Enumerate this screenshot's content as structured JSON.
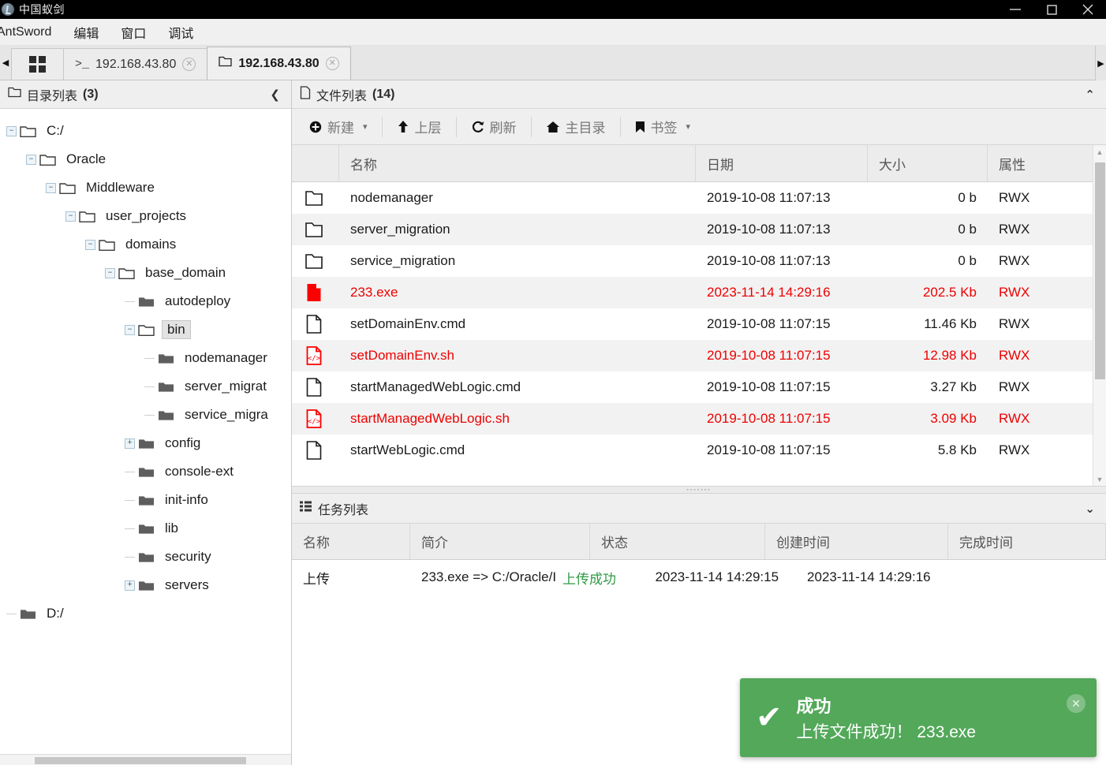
{
  "window": {
    "title": "中国蚁剑",
    "logo_icon": "antsword-logo-icon",
    "minimize_icon": "minimize-icon",
    "maximize_icon": "maximize-icon",
    "close_icon": "close-icon"
  },
  "menubar": {
    "items": [
      {
        "label": "AntSword"
      },
      {
        "label": "编辑"
      },
      {
        "label": "窗口"
      },
      {
        "label": "调试"
      }
    ]
  },
  "tabbar": {
    "scroll_left_icon": "chevron-left-icon",
    "scroll_right_icon": "chevron-right-icon",
    "home_tab_icon": "grid-icon",
    "tabs": [
      {
        "label": "192.168.43.80",
        "icon": "terminal-icon",
        "active": false,
        "close_icon": "close-circle-icon"
      },
      {
        "label": "192.168.43.80",
        "icon": "folder-icon",
        "active": true,
        "close_icon": "close-circle-icon"
      }
    ]
  },
  "sidebar": {
    "title": "目录列表",
    "count": "(3)",
    "title_icon": "folder-icon",
    "collapse_icon": "chevron-left-icon",
    "tree": [
      {
        "label": "C:/",
        "depth": 0,
        "expander": "minus",
        "icon": "folder-open-icon",
        "selected": false
      },
      {
        "label": "Oracle",
        "depth": 1,
        "expander": "minus",
        "icon": "folder-open-icon",
        "selected": false
      },
      {
        "label": "Middleware",
        "depth": 2,
        "expander": "minus",
        "icon": "folder-open-icon",
        "selected": false
      },
      {
        "label": "user_projects",
        "depth": 3,
        "expander": "minus",
        "icon": "folder-open-icon",
        "selected": false
      },
      {
        "label": "domains",
        "depth": 4,
        "expander": "minus",
        "icon": "folder-open-icon",
        "selected": false
      },
      {
        "label": "base_domain",
        "depth": 5,
        "expander": "minus",
        "icon": "folder-open-icon",
        "selected": false
      },
      {
        "label": "autodeploy",
        "depth": 6,
        "expander": "leaf",
        "icon": "folder-closed-icon",
        "selected": false
      },
      {
        "label": "bin",
        "depth": 6,
        "expander": "minus",
        "icon": "folder-open-icon",
        "selected": true
      },
      {
        "label": "nodemanager",
        "depth": 7,
        "expander": "leaf",
        "icon": "folder-closed-icon",
        "selected": false
      },
      {
        "label": "server_migrat",
        "depth": 7,
        "expander": "leaf",
        "icon": "folder-closed-icon",
        "selected": false
      },
      {
        "label": "service_migra",
        "depth": 7,
        "expander": "leaf",
        "icon": "folder-closed-icon",
        "selected": false
      },
      {
        "label": "config",
        "depth": 6,
        "expander": "plus",
        "icon": "folder-closed-icon",
        "selected": false
      },
      {
        "label": "console-ext",
        "depth": 6,
        "expander": "leaf",
        "icon": "folder-closed-icon",
        "selected": false
      },
      {
        "label": "init-info",
        "depth": 6,
        "expander": "leaf",
        "icon": "folder-closed-icon",
        "selected": false
      },
      {
        "label": "lib",
        "depth": 6,
        "expander": "leaf",
        "icon": "folder-closed-icon",
        "selected": false
      },
      {
        "label": "security",
        "depth": 6,
        "expander": "leaf",
        "icon": "folder-closed-icon",
        "selected": false
      },
      {
        "label": "servers",
        "depth": 6,
        "expander": "plus",
        "icon": "folder-closed-icon",
        "selected": false
      },
      {
        "label": "D:/",
        "depth": 0,
        "expander": "leaf",
        "icon": "folder-closed-icon",
        "selected": false
      }
    ]
  },
  "filelist": {
    "title": "文件列表",
    "count": "(14)",
    "title_icon": "file-icon",
    "collapse_icon": "chevron-up-icon",
    "toolbar": [
      {
        "label": "新建",
        "icon": "plus-circle-icon",
        "caret": "▾"
      },
      {
        "label": "上层",
        "icon": "arrow-up-icon",
        "caret": ""
      },
      {
        "label": "刷新",
        "icon": "refresh-icon",
        "caret": ""
      },
      {
        "label": "主目录",
        "icon": "home-icon",
        "caret": ""
      },
      {
        "label": "书签",
        "icon": "bookmark-icon",
        "caret": "▾"
      }
    ],
    "columns": [
      "",
      "名称",
      "日期",
      "大小",
      "属性"
    ],
    "rows": [
      {
        "name": "nodemanager",
        "date": "2019-10-08 11:07:13",
        "size": "0 b",
        "attr": "RWX",
        "icon": "folder-icon",
        "red": false
      },
      {
        "name": "server_migration",
        "date": "2019-10-08 11:07:13",
        "size": "0 b",
        "attr": "RWX",
        "icon": "folder-icon",
        "red": false
      },
      {
        "name": "service_migration",
        "date": "2019-10-08 11:07:13",
        "size": "0 b",
        "attr": "RWX",
        "icon": "folder-icon",
        "red": false
      },
      {
        "name": "233.exe",
        "date": "2023-11-14 14:29:16",
        "size": "202.5 Kb",
        "attr": "RWX",
        "icon": "exe-file-icon",
        "red": true
      },
      {
        "name": "setDomainEnv.cmd",
        "date": "2019-10-08 11:07:15",
        "size": "11.46 Kb",
        "attr": "RWX",
        "icon": "file-icon",
        "red": false
      },
      {
        "name": "setDomainEnv.sh",
        "date": "2019-10-08 11:07:15",
        "size": "12.98 Kb",
        "attr": "RWX",
        "icon": "code-file-icon",
        "red": true
      },
      {
        "name": "startManagedWebLogic.cmd",
        "date": "2019-10-08 11:07:15",
        "size": "3.27 Kb",
        "attr": "RWX",
        "icon": "file-icon",
        "red": false
      },
      {
        "name": "startManagedWebLogic.sh",
        "date": "2019-10-08 11:07:15",
        "size": "3.09 Kb",
        "attr": "RWX",
        "icon": "code-file-icon",
        "red": true
      },
      {
        "name": "startWebLogic.cmd",
        "date": "2019-10-08 11:07:15",
        "size": "5.8 Kb",
        "attr": "RWX",
        "icon": "file-icon",
        "red": false
      }
    ],
    "scrollbar": {
      "up_icon": "triangle-up-icon",
      "down_icon": "triangle-down-icon"
    }
  },
  "tasks": {
    "title": "任务列表",
    "title_icon": "list-icon",
    "collapse_icon": "chevron-down-icon",
    "columns": [
      "名称",
      "简介",
      "状态",
      "创建时间",
      "完成时间"
    ],
    "rows": [
      {
        "name": "上传",
        "desc": "233.exe => C:/Oracle/I",
        "state": "上传成功",
        "created": "2023-11-14 14:29:15",
        "finished": "2023-11-14 14:29:16"
      }
    ]
  },
  "toast": {
    "icon": "check-icon",
    "title": "成功",
    "message": "上传文件成功！  233.exe",
    "close_icon": "close-icon",
    "color": "#53a85a"
  }
}
